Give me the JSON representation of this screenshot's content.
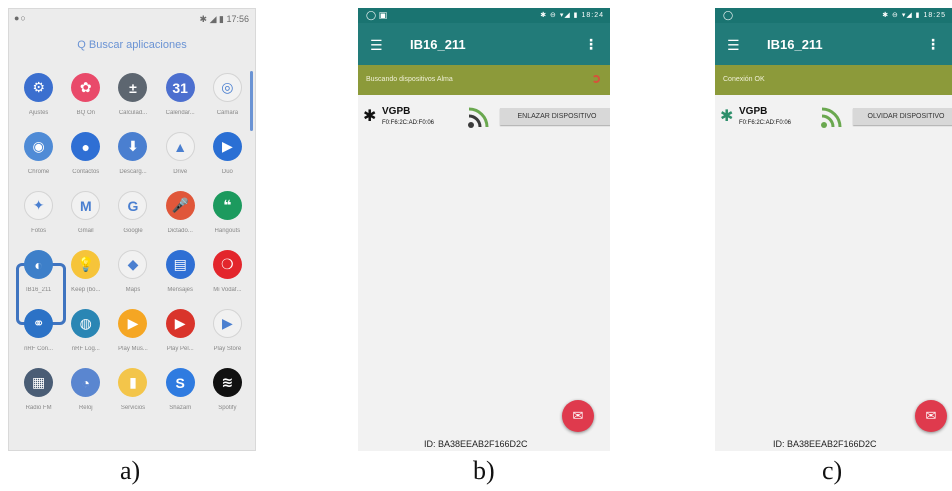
{
  "captions": {
    "a": "a)",
    "b": "b)",
    "c": "c)"
  },
  "panel_a": {
    "status_left": "●○",
    "status_right": "✱ ◢ ▮ 17:56",
    "search_placeholder": "Q Buscar aplicaciones",
    "apps": [
      {
        "label": "Ajustes",
        "icon": "gear-icon",
        "glyph": "⚙",
        "color": "#3b6fcf"
      },
      {
        "label": "BQ On",
        "icon": "petals-icon",
        "glyph": "✿",
        "color": "#e94a6a"
      },
      {
        "label": "Calculad...",
        "icon": "calculator-icon",
        "glyph": "±",
        "color": "#5d6670"
      },
      {
        "label": "Calendar...",
        "icon": "calendar-icon",
        "glyph": "31",
        "color": "#4c6fcf"
      },
      {
        "label": "Cámara",
        "icon": "camera-icon",
        "glyph": "◎",
        "color": "#f2f2f2"
      },
      {
        "label": "Chrome",
        "icon": "chrome-icon",
        "glyph": "◉",
        "color": "#4f8bd6"
      },
      {
        "label": "Contactos",
        "icon": "contacts-icon",
        "glyph": "●",
        "color": "#2f6fd4"
      },
      {
        "label": "Descarg...",
        "icon": "download-icon",
        "glyph": "⬇",
        "color": "#4a7fd0"
      },
      {
        "label": "Drive",
        "icon": "drive-icon",
        "glyph": "▲",
        "color": "#f1f1f1"
      },
      {
        "label": "Duo",
        "icon": "duo-icon",
        "glyph": "▶",
        "color": "#2a6fd4"
      },
      {
        "label": "Fotos",
        "icon": "photos-icon",
        "glyph": "✦",
        "color": "#f1f1f1"
      },
      {
        "label": "Gmail",
        "icon": "gmail-icon",
        "glyph": "M",
        "color": "#f1f1f1"
      },
      {
        "label": "Google",
        "icon": "google-icon",
        "glyph": "G",
        "color": "#f1f1f1"
      },
      {
        "label": "Dictado...",
        "icon": "microphone-icon",
        "glyph": "🎤",
        "color": "#e0573a"
      },
      {
        "label": "Hangouts",
        "icon": "hangouts-icon",
        "glyph": "❝",
        "color": "#1c9a5e"
      },
      {
        "label": "IB16_211",
        "icon": "ib16-app-icon",
        "glyph": "◐",
        "color": "#3d7fc9"
      },
      {
        "label": "Keep (bo...",
        "icon": "keep-icon",
        "glyph": "💡",
        "color": "#f6c43a"
      },
      {
        "label": "Maps",
        "icon": "maps-icon",
        "glyph": "◆",
        "color": "#f1f1f1"
      },
      {
        "label": "Mensajes",
        "icon": "messages-icon",
        "glyph": "▤",
        "color": "#2f6fd4"
      },
      {
        "label": "Mi Vodaf...",
        "icon": "vodafone-icon",
        "glyph": "❍",
        "color": "#e3262c"
      },
      {
        "label": "nRF Con...",
        "icon": "nrf-connect-icon",
        "glyph": "⚭",
        "color": "#2c72c6"
      },
      {
        "label": "nRF Log...",
        "icon": "nrf-logger-icon",
        "glyph": "◍",
        "color": "#2a86b4"
      },
      {
        "label": "Play Mús...",
        "icon": "play-music-icon",
        "glyph": "▶",
        "color": "#f5a623"
      },
      {
        "label": "Play Pel...",
        "icon": "play-movies-icon",
        "glyph": "▶",
        "color": "#d9342b"
      },
      {
        "label": "Play Store",
        "icon": "play-store-icon",
        "glyph": "▶",
        "color": "#f1f1f1"
      },
      {
        "label": "Radio FM",
        "icon": "radio-icon",
        "glyph": "▦",
        "color": "#4a5d75"
      },
      {
        "label": "Reloj",
        "icon": "clock-icon",
        "glyph": "◔",
        "color": "#5a86d0"
      },
      {
        "label": "Servicios",
        "icon": "files-icon",
        "glyph": "▮",
        "color": "#f3c54a"
      },
      {
        "label": "Shazam",
        "icon": "shazam-icon",
        "glyph": "S",
        "color": "#2f7be0"
      },
      {
        "label": "Spotify",
        "icon": "spotify-icon",
        "glyph": "≋",
        "color": "#111111"
      }
    ]
  },
  "panel_b": {
    "status_left": "◯ ▣",
    "status_right": "✱ ⊖ ▾◢ ▮ 18:24",
    "app_title": "IB16_211",
    "status_text": "Buscando dispositivos Alma",
    "device_name": "VGPB",
    "device_mac": "F0:F6:2C:AD:F0:06",
    "device_button": "ENLAZAR DISPOSITIVO",
    "device_id": "ID: BA38EEAB2F166D2C"
  },
  "panel_c": {
    "status_left": "◯",
    "status_right": "✱ ⊖ ▾◢ ▮ 18:25",
    "app_title": "IB16_211",
    "status_text": "Conexión OK",
    "device_name": "VGPB",
    "device_mac": "F0:F6:2C:AD:F0:06",
    "device_button": "OLVIDAR DISPOSITIVO",
    "device_id": "ID: BA38EEAB2F166D2C"
  },
  "colors": {
    "teal": "#227b79",
    "olive": "#8c9a3a",
    "fab": "#df3a4d",
    "highlight": "#3f74c0"
  }
}
